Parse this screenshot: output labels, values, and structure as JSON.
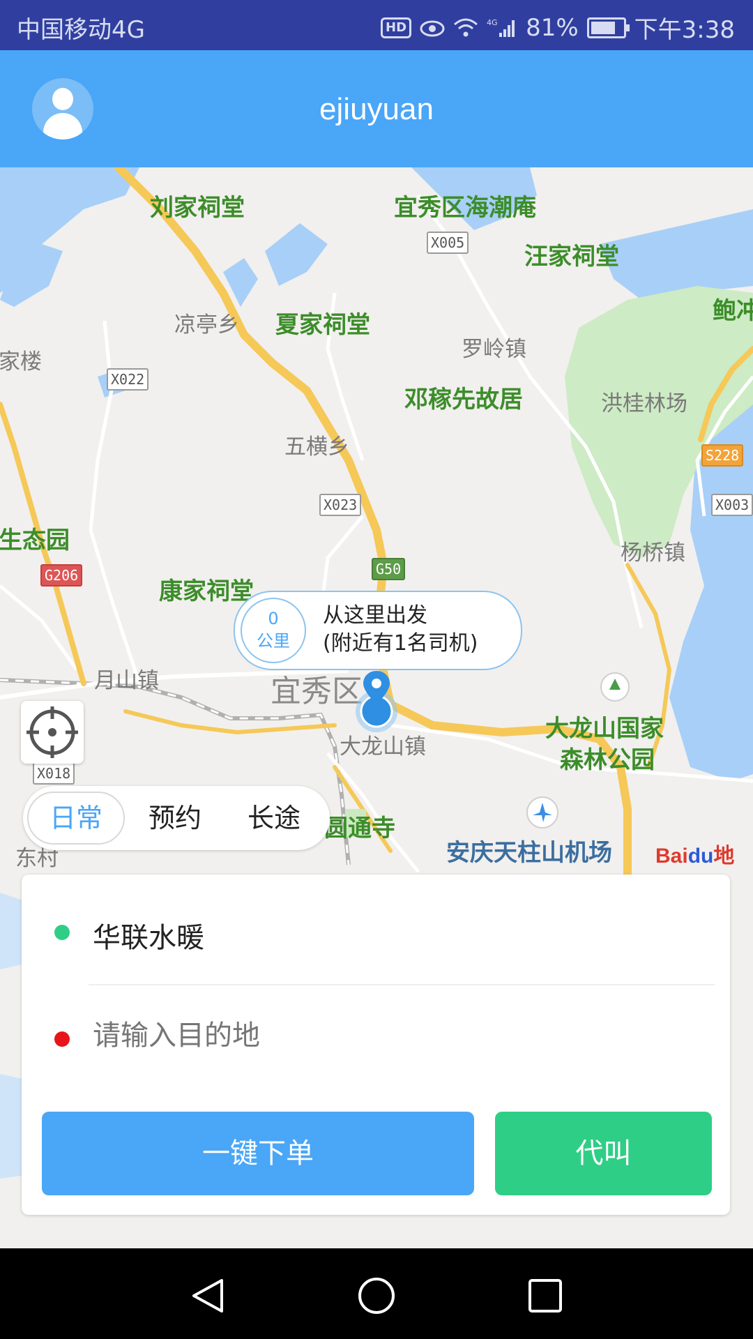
{
  "status_bar": {
    "carrier": "中国移动4G",
    "battery_percent": "81%",
    "time": "下午3:38",
    "icons": [
      "hd-icon",
      "eye-icon",
      "wifi-icon",
      "signal-4g-icon",
      "battery-icon"
    ],
    "hd_text": "HD"
  },
  "app_bar": {
    "title": "ejiuyuan",
    "avatar_icon": "user-avatar-icon"
  },
  "map": {
    "pois": [
      "刘家祠堂",
      "宜秀区海潮庵",
      "汪家祠堂",
      "夏家祠堂",
      "邓稼先故居",
      "康家祠堂",
      "大龙山国家",
      "森林公园",
      "圆通寺",
      "生态园",
      "鲍冲"
    ],
    "places": [
      "凉亭乡",
      "罗岭镇",
      "洪桂林场",
      "五横乡",
      "杨桥镇",
      "月山镇",
      "宜秀区",
      "大龙山镇",
      "东村",
      "家楼"
    ],
    "road_badges": [
      "X005",
      "X022",
      "X023",
      "G50",
      "G206",
      "S228",
      "X003",
      "X018"
    ],
    "airport": "安庆天柱山机场",
    "callout": {
      "distance_value": "0",
      "distance_unit": "公里",
      "line1": "从这里出发",
      "line2": "(附近有1名司机)"
    },
    "baidu_logo": "Bai地图",
    "baidu_logo_part1": "Bai",
    "baidu_logo_part2": "du",
    "baidu_logo_part3": "地图"
  },
  "mode_tabs": {
    "items": [
      "日常",
      "预约",
      "长途"
    ],
    "active": "日常"
  },
  "order_card": {
    "origin": "华联水暖",
    "destination_placeholder": "请输入目的地",
    "origin_dot_color": "#2fce86",
    "destination_dot_color": "#e8141a",
    "order_button": "一键下单",
    "proxy_button": "代叫"
  },
  "colors": {
    "status_bar": "#303f9f",
    "app_bar": "#4aa6f7",
    "primary_blue": "#4aa6f7",
    "green": "#2fce86"
  },
  "nav_bar": {
    "icons": [
      "back-triangle-icon",
      "home-circle-icon",
      "recents-square-icon"
    ]
  }
}
